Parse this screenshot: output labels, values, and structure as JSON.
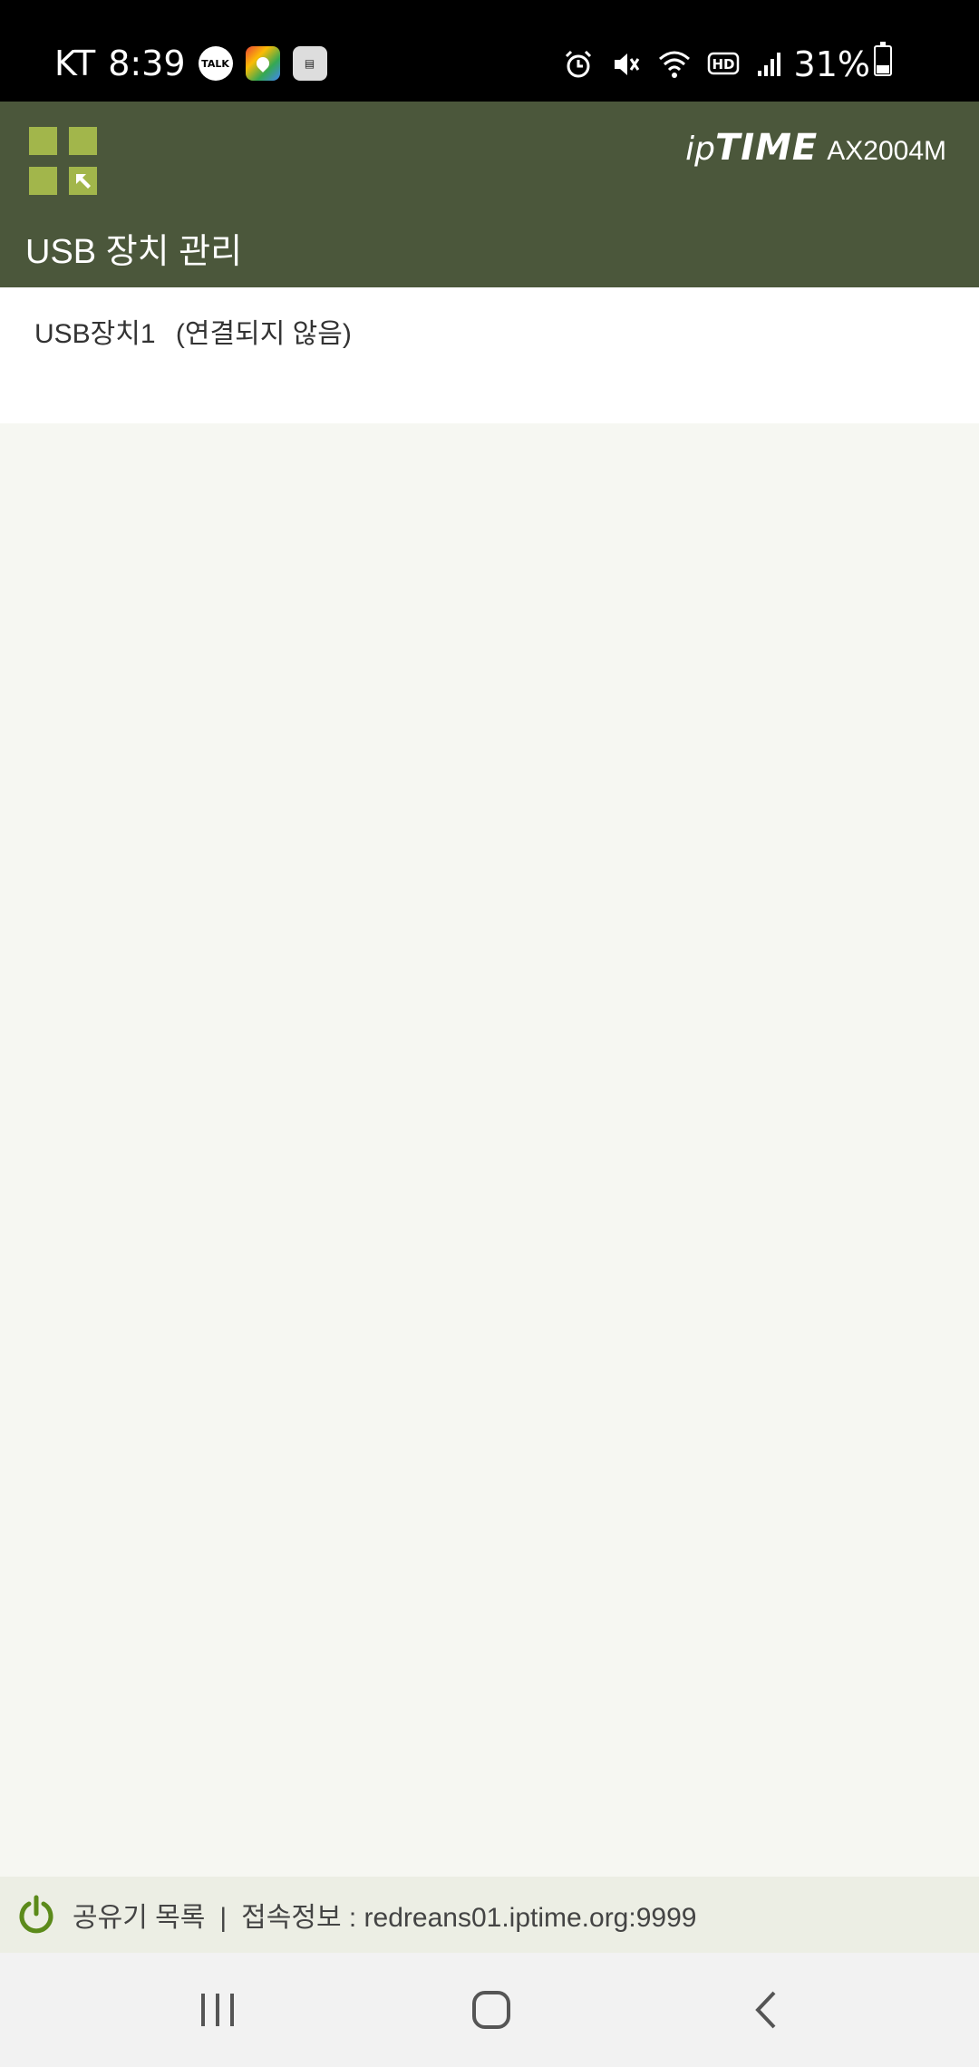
{
  "status_bar": {
    "carrier": "KT",
    "time": "8:39",
    "notifications": [
      "talk-icon",
      "map-icon",
      "news-icon"
    ],
    "notif_talk_text": "TALK",
    "battery_percent": "31%",
    "battery_level": 0.31
  },
  "header": {
    "brand_ip": "ip",
    "brand_time": "TIME",
    "model": "AX2004M",
    "title": "USB 장치 관리",
    "accent_color": "#a2b64b",
    "background_color": "#4b573b"
  },
  "devices": [
    {
      "name": "USB장치1",
      "status": "(연결되지 않음)"
    }
  ],
  "footer": {
    "router_list": "공유기 목록",
    "separator": "|",
    "connection_info": "접속정보 : redreans01.iptime.org:9999"
  },
  "navbar": {
    "recent": "recent-apps-icon",
    "home": "home-icon",
    "back": "back-icon"
  }
}
